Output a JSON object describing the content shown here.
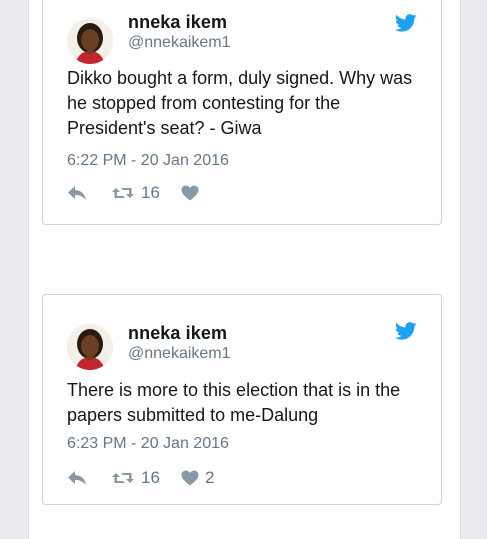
{
  "tweets": [
    {
      "name": "nneka ikem",
      "handle": "@nnekaikem1",
      "text": "Dikko bought a form, duly signed. Why was he stopped from contesting for the President's seat? - Giwa",
      "timestamp": "6:22 PM - 20 Jan 2016",
      "retweets": "16",
      "likes": "",
      "icons": [
        "reply-icon",
        "retweet-icon",
        "heart-icon",
        "twitter-bird-icon"
      ]
    },
    {
      "name": "nneka ikem",
      "handle": "@nnekaikem1",
      "text": "There is more to this election that is in the papers submitted to me-Dalung",
      "timestamp": "6:23 PM - 20 Jan 2016",
      "retweets": "16",
      "likes": "2",
      "icons": [
        "reply-icon",
        "retweet-icon",
        "heart-icon",
        "twitter-bird-icon"
      ]
    }
  ],
  "colors": {
    "twitter_blue": "#1da1f2",
    "action_gray": "#8899a6",
    "text": "#14171a",
    "muted": "#657786",
    "border": "#cfd3d7"
  }
}
